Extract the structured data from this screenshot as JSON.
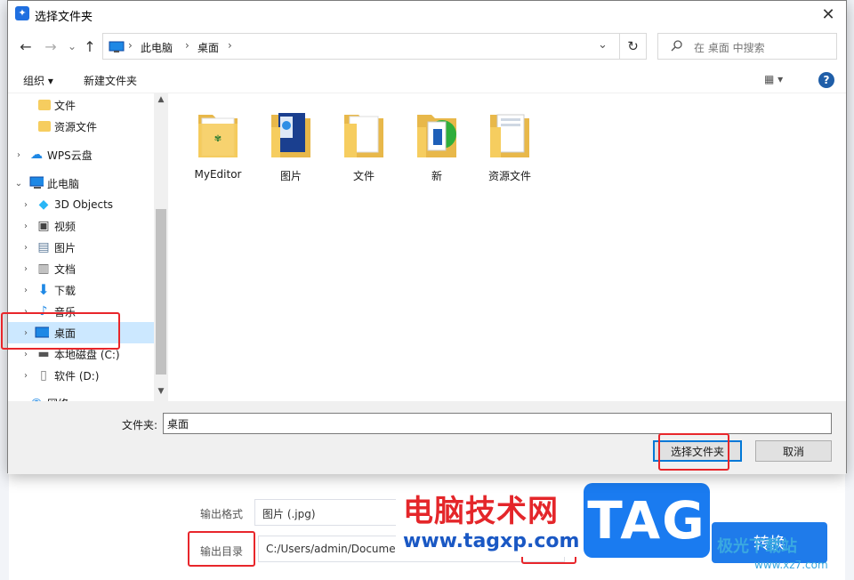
{
  "dialog": {
    "title": "选择文件夹",
    "close_glyph": "✕"
  },
  "nav": {
    "back_glyph": "←",
    "forward_glyph": "→",
    "recent_glyph": "⌄",
    "up_glyph": "↑",
    "breadcrumbs": [
      "此电脑",
      "桌面"
    ],
    "crumb_sep": "›",
    "dropdown_glyph": "⌄",
    "refresh_glyph": "↻",
    "search_placeholder": "在 桌面 中搜索"
  },
  "toolbar": {
    "organize": "组织 ▾",
    "new_folder": "新建文件夹",
    "view": "▦ ▾",
    "help": "?"
  },
  "tree": [
    {
      "label": "文件",
      "icon": "folder-icon",
      "level": 2,
      "arrow": ""
    },
    {
      "label": "资源文件",
      "icon": "folder-icon",
      "level": 2,
      "arrow": ""
    },
    {
      "label": "WPS云盘",
      "icon": "cloud-icon",
      "level": 1,
      "arrow": "›"
    },
    {
      "label": "此电脑",
      "icon": "computer-icon",
      "level": 1,
      "arrow": "⌄"
    },
    {
      "label": "3D Objects",
      "icon": "cube-icon",
      "level": 2,
      "arrow": "›"
    },
    {
      "label": "视频",
      "icon": "video-icon",
      "level": 2,
      "arrow": "›"
    },
    {
      "label": "图片",
      "icon": "picture-icon",
      "level": 2,
      "arrow": "›"
    },
    {
      "label": "文档",
      "icon": "document-icon",
      "level": 2,
      "arrow": "›"
    },
    {
      "label": "下载",
      "icon": "download-icon",
      "level": 2,
      "arrow": "›"
    },
    {
      "label": "音乐",
      "icon": "music-icon",
      "level": 2,
      "arrow": "›"
    },
    {
      "label": "桌面",
      "icon": "desktop-icon",
      "level": 2,
      "arrow": "›",
      "selected": true
    },
    {
      "label": "本地磁盘 (C:)",
      "icon": "drive-icon",
      "level": 2,
      "arrow": "›"
    },
    {
      "label": "软件 (D:)",
      "icon": "drive-icon",
      "level": 2,
      "arrow": "›"
    },
    {
      "label": "网络",
      "icon": "network-icon",
      "level": 1,
      "arrow": "›"
    }
  ],
  "files": [
    {
      "name": "MyEditor"
    },
    {
      "name": "图片"
    },
    {
      "name": "文件"
    },
    {
      "name": "新"
    },
    {
      "name": "资源文件"
    }
  ],
  "footer": {
    "folder_label": "文件夹:",
    "folder_value": "桌面",
    "select_button": "选择文件夹",
    "cancel_button": "取消"
  },
  "background": {
    "output_format_label": "输出格式",
    "output_format_value": "图片 (.jpg)",
    "output_dir_label": "输出目录",
    "output_dir_value": "C:/Users/admin/Documents/LightPDF",
    "convert_button": "转换"
  },
  "watermark": {
    "cn_text": "电脑技术网",
    "url_text": "www.tagxp.com",
    "tag_text": "TAG",
    "xz_text": "极光下载站",
    "xz_url": "www.xz7.com"
  },
  "colors": {
    "accent": "#0078d7",
    "selected_bg": "#cce8ff",
    "folder": "#f6cd5f",
    "highlight_red": "#e8262b"
  }
}
